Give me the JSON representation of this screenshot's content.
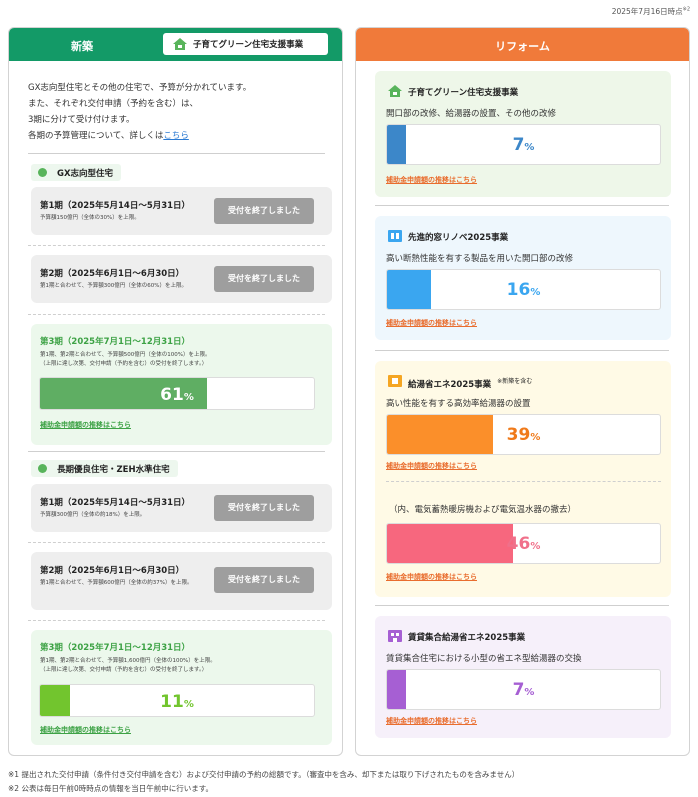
{
  "timestamp": "2025年7月16日時点",
  "timestamp_sup": "※2",
  "left": {
    "title": "新築",
    "program_button": "子育てグリーン住宅支援事業",
    "intro_lines": [
      "GX志向型住宅とその他の住宅で、予算が分かれています。",
      "また、それぞれ交付申請（予約を含む）は、",
      "3期に分けて受け付けます。",
      "各期の予算管理について、詳しくは"
    ],
    "intro_link": "こちら",
    "categories": [
      {
        "name": "GX志向型住宅",
        "periods": [
          {
            "title": "第1期（2025年5月14日〜5月31日）",
            "sub": "予算額150億円（全体の30%）を上限。",
            "status": "受付を終了しました"
          },
          {
            "title": "第2期（2025年6月1日〜6月30日）",
            "sub": "第1期と合わせて、予算額300億円（全体の60%）を上限。",
            "status": "受付を終了しました"
          },
          {
            "title": "第3期（2025年7月1日〜12月31日）",
            "sub1": "第1期、第2期と合わせて、予算額500億円（全体の100%）を上限。",
            "sub2": "（上限に達し次第、交付申請（予約を含む）の受付を終了します。）",
            "percent": 61,
            "percent_label": "61",
            "unit": "%",
            "link": "補助金申請額の推移はこちら",
            "color": "#5fae63"
          }
        ]
      },
      {
        "name": "長期優良住宅・ZEH水準住宅",
        "periods": [
          {
            "title": "第1期（2025年5月14日〜5月31日）",
            "sub": "予算額300億円（全体の約18%）を上限。",
            "status": "受付を終了しました"
          },
          {
            "title": "第2期（2025年6月1日〜6月30日）",
            "sub": "第1期と合わせて、予算額600億円（全体の約37%）を上限。",
            "status": "受付を終了しました"
          },
          {
            "title": "第3期（2025年7月1日〜12月31日）",
            "sub1": "第1期、第2期と合わせて、予算額1,600億円（全体の100%）を上限。",
            "sub2": "（上限に達し次第、交付申請（予約を含む）の受付を終了します。）",
            "percent": 11,
            "percent_label": "11",
            "unit": "%",
            "link": "補助金申請額の推移はこちら",
            "color": "#72c52e"
          }
        ]
      }
    ]
  },
  "right": {
    "title": "リフォーム",
    "cards": [
      {
        "name": "子育てグリーン住宅支援事業",
        "desc": "開口部の改修、給湯器の設置、その他の改修",
        "percent": 7,
        "percent_label": "7",
        "unit": "%",
        "link": "補助金申請額の推移はこちら",
        "color": "#3c87c9",
        "text_color": "#3c87c9",
        "bg": "#eef7e9",
        "icon_color": "#58b45b"
      },
      {
        "name": "先進的窓リノベ2025事業",
        "desc": "高い断熱性能を有する製品を用いた開口部の改修",
        "percent": 16,
        "percent_label": "16",
        "unit": "%",
        "link": "補助金申請額の推移はこちら",
        "color": "#3aa6f0",
        "text_color": "#3aa6f0",
        "bg": "#eef7fd",
        "icon_color": "#3aa6f0"
      },
      {
        "name": "給湯省エネ2025事業",
        "note": "※新築を含む",
        "desc": "高い性能を有する高効率給湯器の設置",
        "percent": 39,
        "percent_label": "39",
        "unit": "%",
        "link": "補助金申請額の推移はこちら",
        "color": "#fb8f2a",
        "text_color": "#f07a1a",
        "bg": "#fffae6",
        "icon_color": "#f5a623",
        "sub": {
          "desc": "（内、電気蓄熱暖房機および電気温水器の撤去）",
          "percent": 46,
          "percent_label": "46",
          "unit": "%",
          "link": "補助金申請額の推移はこちら",
          "color": "#f7677e",
          "text_color": "#f0708a"
        }
      },
      {
        "name": "賃貸集合給湯省エネ2025事業",
        "desc": "賃貸集合住宅における小型の省エネ型給湯器の交換",
        "percent": 7,
        "percent_label": "7",
        "unit": "%",
        "link": "補助金申請額の推移はこちら",
        "color": "#a65fd3",
        "text_color": "#a65fd3",
        "bg": "#f6f0fa",
        "icon_color": "#a65fd3"
      }
    ]
  },
  "notes": [
    "※1 提出された交付申請（条件付き交付申請を含む）および交付申請の予約の総額です。（審査中を含み、却下または取り下げされたものを含みません）",
    "※2 公表は毎日午前0時時点の情報を当日午前中に行います。"
  ]
}
